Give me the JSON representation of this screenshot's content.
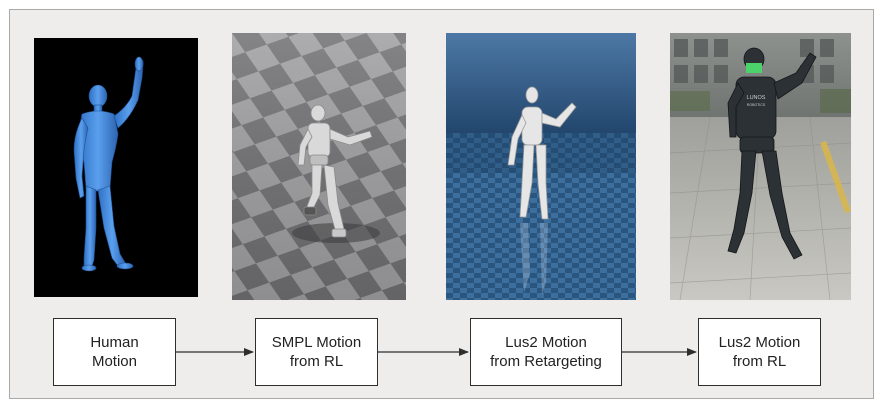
{
  "pipeline": {
    "steps": [
      {
        "line1": "Human",
        "line2": "Motion"
      },
      {
        "line1": "SMPL Motion",
        "line2": "from RL"
      },
      {
        "line1": "Lus2 Motion",
        "line2": "from Retargeting"
      },
      {
        "line1": "Lus2 Motion",
        "line2": "from RL"
      }
    ],
    "robot_chest_logo": {
      "line1": "LUNOS",
      "line2": "ROBOTICS"
    }
  },
  "colors": {
    "frame_background": "#efecec",
    "human_mesh": "#4a90e2",
    "checker_light": "#9e9ea0",
    "checker_dark": "#6f6f72",
    "sim_sky": "#2f5a85",
    "sim_floor": "#3c6f9e"
  },
  "icons": [
    "human-mesh-figure",
    "humanoid-robot-figure",
    "arrow-right-icon"
  ]
}
